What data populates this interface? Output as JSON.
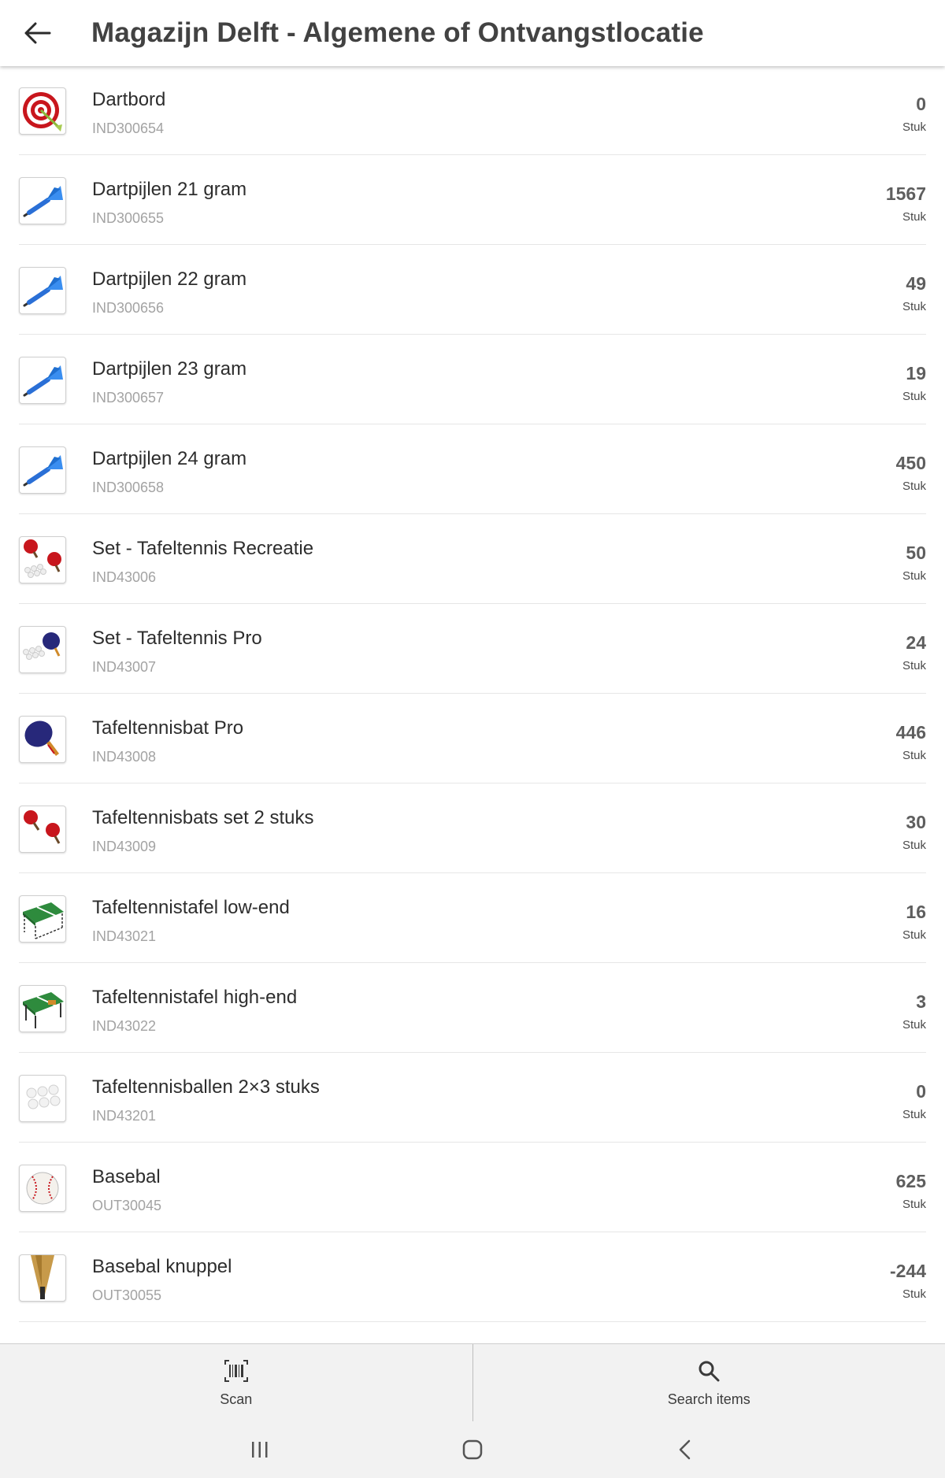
{
  "header": {
    "title": "Magazijn Delft - Algemene of Ontvangstlocatie",
    "back_icon": "arrow-left-icon"
  },
  "items": [
    {
      "name": "Dartbord",
      "code": "IND300654",
      "qty": "0",
      "unit": "Stuk",
      "icon": "dartboard-icon"
    },
    {
      "name": "Dartpijlen 21 gram",
      "code": "IND300655",
      "qty": "1567",
      "unit": "Stuk",
      "icon": "dart-icon"
    },
    {
      "name": "Dartpijlen 22 gram",
      "code": "IND300656",
      "qty": "49",
      "unit": "Stuk",
      "icon": "dart-icon"
    },
    {
      "name": "Dartpijlen 23 gram",
      "code": "IND300657",
      "qty": "19",
      "unit": "Stuk",
      "icon": "dart-icon"
    },
    {
      "name": "Dartpijlen 24 gram",
      "code": "IND300658",
      "qty": "450",
      "unit": "Stuk",
      "icon": "dart-icon"
    },
    {
      "name": "Set - Tafeltennis Recreatie",
      "code": "IND43006",
      "qty": "50",
      "unit": "Stuk",
      "icon": "paddle-set-red-icon"
    },
    {
      "name": "Set - Tafeltennis Pro",
      "code": "IND43007",
      "qty": "24",
      "unit": "Stuk",
      "icon": "paddle-set-blue-icon"
    },
    {
      "name": "Tafeltennisbat Pro",
      "code": "IND43008",
      "qty": "446",
      "unit": "Stuk",
      "icon": "paddle-blue-icon"
    },
    {
      "name": "Tafeltennisbats set 2 stuks",
      "code": "IND43009",
      "qty": "30",
      "unit": "Stuk",
      "icon": "paddle-pair-red-icon"
    },
    {
      "name": "Tafeltennistafel low-end",
      "code": "IND43021",
      "qty": "16",
      "unit": "Stuk",
      "icon": "table-tennis-table-icon"
    },
    {
      "name": "Tafeltennistafel high-end",
      "code": "IND43022",
      "qty": "3",
      "unit": "Stuk",
      "icon": "table-tennis-table-icon"
    },
    {
      "name": "Tafeltennisballen 2×3 stuks",
      "code": "IND43201",
      "qty": "0",
      "unit": "Stuk",
      "icon": "table-tennis-balls-icon"
    },
    {
      "name": "Basebal",
      "code": "OUT30045",
      "qty": "625",
      "unit": "Stuk",
      "icon": "baseball-icon"
    },
    {
      "name": "Basebal knuppel",
      "code": "OUT30055",
      "qty": "-244",
      "unit": "Stuk",
      "icon": "baseball-bat-icon"
    }
  ],
  "bottom_bar": {
    "scan_label": "Scan",
    "scan_icon": "barcode-icon",
    "search_label": "Search items",
    "search_icon": "search-icon"
  },
  "system_nav": {
    "recents_icon": "recent-apps-icon",
    "home_icon": "home-icon",
    "back_icon": "back-chevron-icon"
  }
}
